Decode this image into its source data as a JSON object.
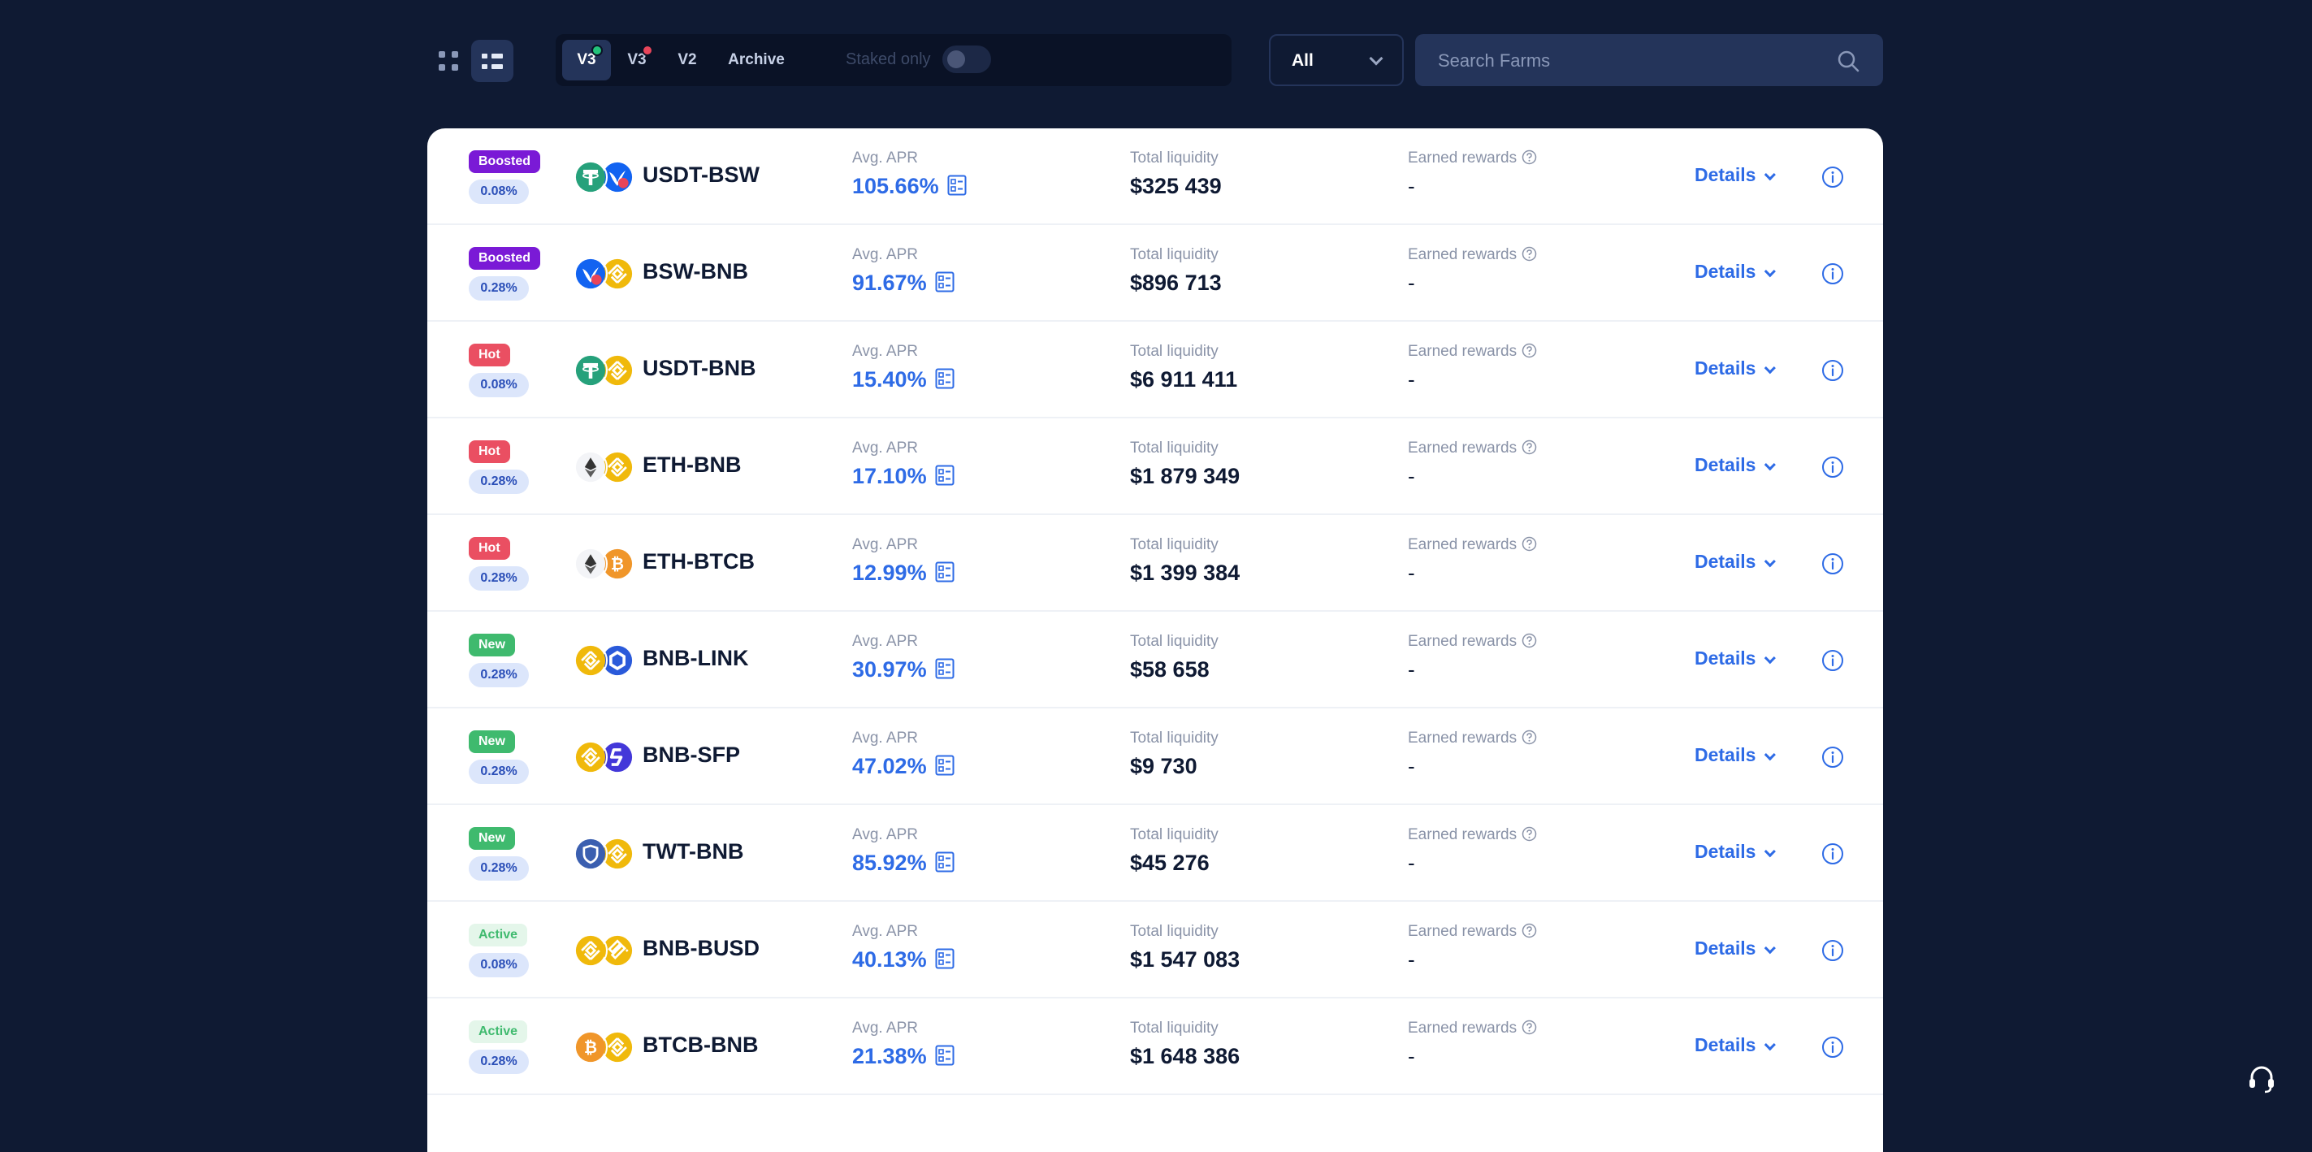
{
  "toolbar": {
    "tabs": [
      {
        "label": "V3",
        "active": true,
        "dot": "green"
      },
      {
        "label": "V3",
        "active": false,
        "dot": "red"
      },
      {
        "label": "V2",
        "active": false
      },
      {
        "label": "Archive",
        "active": false
      }
    ],
    "staked_only_label": "Staked only",
    "staked_only_enabled": false,
    "filter_value": "All",
    "search_placeholder": "Search Farms"
  },
  "labels": {
    "apr": "Avg. APR",
    "liquidity": "Total liquidity",
    "earned": "Earned rewards",
    "details": "Details"
  },
  "colors": {
    "page_bg": "#0f1a33",
    "accent": "#2e6be6",
    "boosted": "#7a1ad6",
    "hot": "#ea4f62",
    "new": "#3fba6e"
  },
  "farms": [
    {
      "badge": "Boosted",
      "badge_type": "boosted",
      "fee": "0.08%",
      "pair": "USDT-BSW",
      "tokens": [
        "usdt",
        "bsw"
      ],
      "apr": "105.66%",
      "liquidity": "$325 439",
      "earned": "-"
    },
    {
      "badge": "Boosted",
      "badge_type": "boosted",
      "fee": "0.28%",
      "pair": "BSW-BNB",
      "tokens": [
        "bsw",
        "bnb"
      ],
      "apr": "91.67%",
      "liquidity": "$896 713",
      "earned": "-"
    },
    {
      "badge": "Hot",
      "badge_type": "hot",
      "fee": "0.08%",
      "pair": "USDT-BNB",
      "tokens": [
        "usdt",
        "bnb"
      ],
      "apr": "15.40%",
      "liquidity": "$6 911 411",
      "earned": "-"
    },
    {
      "badge": "Hot",
      "badge_type": "hot",
      "fee": "0.28%",
      "pair": "ETH-BNB",
      "tokens": [
        "eth",
        "bnb"
      ],
      "apr": "17.10%",
      "liquidity": "$1 879 349",
      "earned": "-"
    },
    {
      "badge": "Hot",
      "badge_type": "hot",
      "fee": "0.28%",
      "pair": "ETH-BTCB",
      "tokens": [
        "eth",
        "btcb"
      ],
      "apr": "12.99%",
      "liquidity": "$1 399 384",
      "earned": "-"
    },
    {
      "badge": "New",
      "badge_type": "new",
      "fee": "0.28%",
      "pair": "BNB-LINK",
      "tokens": [
        "bnb",
        "link"
      ],
      "apr": "30.97%",
      "liquidity": "$58 658",
      "earned": "-"
    },
    {
      "badge": "New",
      "badge_type": "new",
      "fee": "0.28%",
      "pair": "BNB-SFP",
      "tokens": [
        "bnb",
        "sfp"
      ],
      "apr": "47.02%",
      "liquidity": "$9 730",
      "earned": "-"
    },
    {
      "badge": "New",
      "badge_type": "new",
      "fee": "0.28%",
      "pair": "TWT-BNB",
      "tokens": [
        "twt",
        "bnb"
      ],
      "apr": "85.92%",
      "liquidity": "$45 276",
      "earned": "-"
    },
    {
      "badge": "Active",
      "badge_type": "active",
      "fee": "0.08%",
      "pair": "BNB-BUSD",
      "tokens": [
        "bnb",
        "busd"
      ],
      "apr": "40.13%",
      "liquidity": "$1 547 083",
      "earned": "-"
    },
    {
      "badge": "Active",
      "badge_type": "active",
      "fee": "0.28%",
      "pair": "BTCB-BNB",
      "tokens": [
        "btcb",
        "bnb"
      ],
      "apr": "21.38%",
      "liquidity": "$1 648 386",
      "earned": "-"
    }
  ]
}
